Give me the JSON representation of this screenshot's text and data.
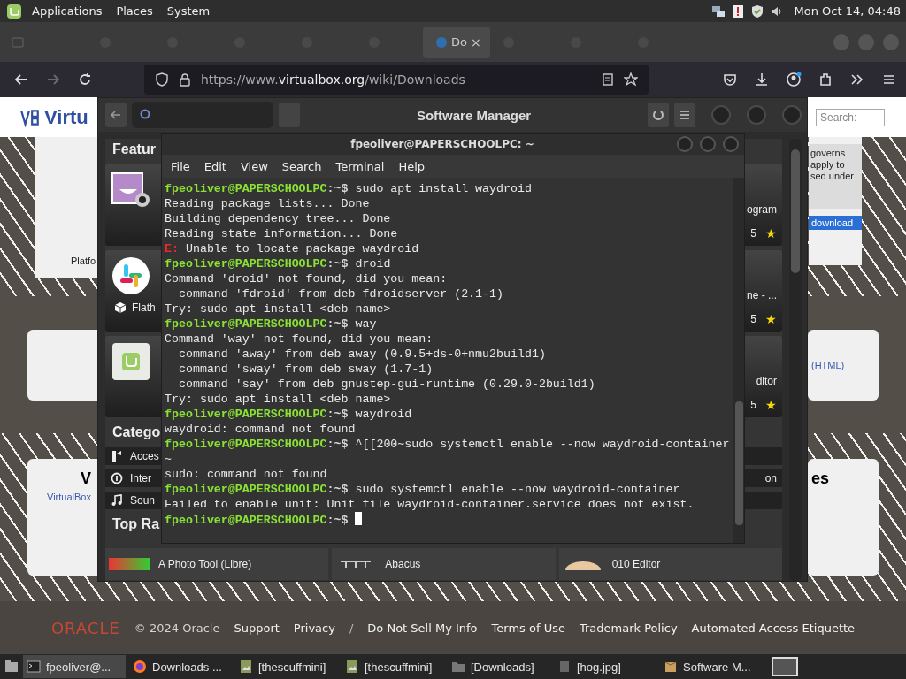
{
  "top_panel": {
    "menus": [
      "Applications",
      "Places",
      "System"
    ],
    "clock": "Mon Oct 14, 04:48"
  },
  "browser": {
    "tabs": [
      {
        "selected": false
      },
      {
        "selected": false
      },
      {
        "selected": false
      },
      {
        "selected": false
      },
      {
        "selected": false
      },
      {
        "label": "Do",
        "close": "×",
        "selected": true
      },
      {
        "selected": false
      },
      {
        "selected": false
      },
      {
        "selected": false
      }
    ],
    "forward_disabled": true,
    "url": {
      "prefix": "https://www.",
      "host": "virtualbox.org",
      "path": "/wiki/Downloads"
    },
    "page": {
      "logo": "Virtu",
      "search_placeholder": "Search:",
      "left_cards": [
        {
          "text": "Platfo"
        },
        {
          "heading": "V",
          "link": "VirtualBox"
        }
      ],
      "right_cards": [
        {
          "lines": [
            "governs",
            "apply to",
            "sed under"
          ],
          "button": "download"
        },
        {
          "link": "(HTML)"
        },
        {
          "heading": "es"
        }
      ]
    },
    "footer": {
      "logo": "ORACLE",
      "items": [
        {
          "kind": "text",
          "text": "© 2024 Oracle"
        },
        {
          "kind": "link",
          "text": "Support"
        },
        {
          "kind": "link",
          "text": "Privacy"
        },
        {
          "kind": "separator",
          "text": "/"
        },
        {
          "kind": "link",
          "text": "Do Not Sell My Info"
        },
        {
          "kind": "link",
          "text": "Terms of Use"
        },
        {
          "kind": "link",
          "text": "Trademark Policy"
        },
        {
          "kind": "link",
          "text": "Automated Access Etiquette"
        }
      ]
    }
  },
  "software_manager": {
    "title": "Software Manager",
    "featured_heading": "Featur",
    "featured": [
      {
        "kind": "webcam",
        "name": "ogram",
        "rating": "5",
        "star": "★"
      },
      {
        "kind": "chat",
        "sublabel": "Flath",
        "name": "ne - ...",
        "rating": "5",
        "star": "★"
      },
      {
        "kind": "mint",
        "name": "ditor",
        "rating": "5",
        "star": "★"
      }
    ],
    "categories_heading": "Catego",
    "categories": [
      {
        "kind": "accessories",
        "label": "Acces"
      },
      {
        "kind": "internet",
        "label": "Inter",
        "trailing": "on"
      },
      {
        "kind": "sound",
        "label": "Soun"
      }
    ],
    "top_rated_heading": "Top Ra",
    "top_rated": [
      {
        "kind": "photo",
        "name": "A Photo Tool (Libre)"
      },
      {
        "kind": "abacus",
        "name": "Abacus"
      },
      {
        "kind": "editor",
        "name": "010 Editor"
      }
    ]
  },
  "terminal": {
    "title": "fpeoliver@PAPERSCHOOLPC: ~",
    "menu": [
      "File",
      "Edit",
      "View",
      "Search",
      "Terminal",
      "Help"
    ],
    "lines": [
      {
        "kind": "prompt",
        "user": "fpeoliver@PAPERSCHOOLPC",
        "path": ":~$",
        "command": " sudo apt install waydroid"
      },
      {
        "kind": "output",
        "text": "Reading package lists... Done"
      },
      {
        "kind": "output",
        "text": "Building dependency tree... Done"
      },
      {
        "kind": "output",
        "text": "Reading state information... Done"
      },
      {
        "kind": "error",
        "tag": "E:",
        "text": " Unable to locate package waydroid"
      },
      {
        "kind": "prompt",
        "user": "fpeoliver@PAPERSCHOOLPC",
        "path": ":~$",
        "command": " droid"
      },
      {
        "kind": "output",
        "text": "Command 'droid' not found, did you mean:"
      },
      {
        "kind": "output",
        "text": "  command 'fdroid' from deb fdroidserver (2.1-1)"
      },
      {
        "kind": "output",
        "text": "Try: sudo apt install <deb name>"
      },
      {
        "kind": "prompt",
        "user": "fpeoliver@PAPERSCHOOLPC",
        "path": ":~$",
        "command": " way"
      },
      {
        "kind": "output",
        "text": "Command 'way' not found, did you mean:"
      },
      {
        "kind": "output",
        "text": "  command 'away' from deb away (0.9.5+ds-0+nmu2build1)"
      },
      {
        "kind": "output",
        "text": "  command 'sway' from deb sway (1.7-1)"
      },
      {
        "kind": "output",
        "text": "  command 'say' from deb gnustep-gui-runtime (0.29.0-2build1)"
      },
      {
        "kind": "output",
        "text": "Try: sudo apt install <deb name>"
      },
      {
        "kind": "prompt",
        "user": "fpeoliver@PAPERSCHOOLPC",
        "path": ":~$",
        "command": " waydroid"
      },
      {
        "kind": "output",
        "text": "waydroid: command not found"
      },
      {
        "kind": "prompt",
        "user": "fpeoliver@PAPERSCHOOLPC",
        "path": ":~$",
        "command": " ^[[200~sudo systemctl enable --now waydroid-container"
      },
      {
        "kind": "output",
        "text": "~"
      },
      {
        "kind": "output",
        "text": "sudo: command not found"
      },
      {
        "kind": "prompt",
        "user": "fpeoliver@PAPERSCHOOLPC",
        "path": ":~$",
        "command": " sudo systemctl enable --now waydroid-container"
      },
      {
        "kind": "output",
        "text": "Failed to enable unit: Unit file waydroid-container.service does not exist."
      },
      {
        "kind": "prompt",
        "user": "fpeoliver@PAPERSCHOOLPC",
        "path": ":~$",
        "cursor": true
      }
    ]
  },
  "taskbar": {
    "items": [
      {
        "kind": "terminal",
        "label": "fpeoliver@...",
        "selected": true
      },
      {
        "kind": "browser",
        "label": "Downloads ...",
        "selected": false
      },
      {
        "kind": "image",
        "label": "[thescuffmini]",
        "selected": false
      },
      {
        "kind": "image",
        "label": "[thescuffmini]",
        "selected": false
      },
      {
        "kind": "folder",
        "label": "[Downloads]",
        "selected": false
      },
      {
        "kind": "file",
        "label": "[hog.jpg]",
        "selected": false
      },
      {
        "kind": "package",
        "label": "Software M...",
        "selected": false
      }
    ]
  }
}
